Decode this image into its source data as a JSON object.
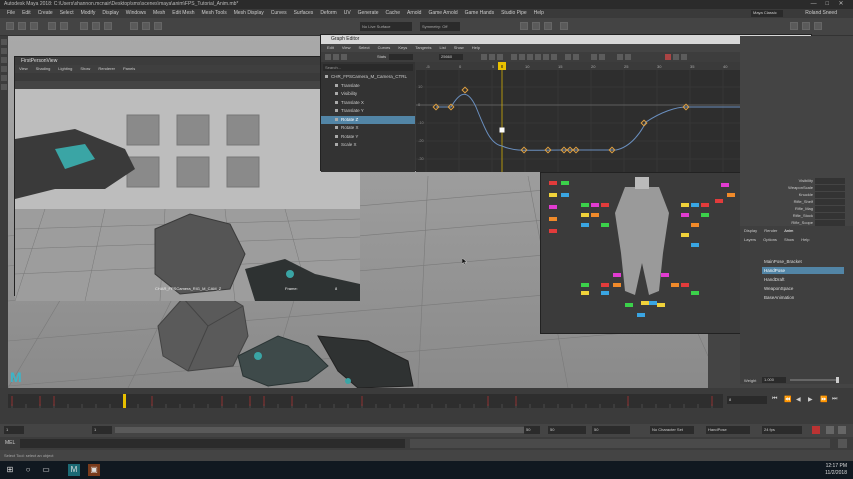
{
  "app": {
    "title": "Autodesk Maya 2018: C:\\Users\\shannon.mcnair\\Desktop\\sms\\scenes\\maya\\anim\\FPS_Tutorial_Anim.mb*",
    "window_buttons": [
      "—",
      "□",
      "✕"
    ]
  },
  "menubar": {
    "items": [
      "File",
      "Edit",
      "Create",
      "Select",
      "Modify",
      "Display",
      "Windows",
      "Mesh",
      "Edit Mesh",
      "Mesh Tools",
      "Mesh Display",
      "Curves",
      "Surfaces",
      "Deform",
      "UV",
      "Generate",
      "Cache",
      "Arnold",
      "Game Arnold",
      "Game Hands",
      "Studio Pipe",
      "Help"
    ],
    "workspace_label": "Workspace:",
    "workspace_value": "Maya Classic",
    "user": "Roland Sneed"
  },
  "shelf": {
    "fields": [
      "No Live Surface",
      "Symmetry: Off"
    ]
  },
  "camera_window": {
    "title": "FirstPersonView",
    "menu": [
      "View",
      "Shading",
      "Lighting",
      "Show",
      "Renderer",
      "Panels"
    ],
    "caption": "CHAR_FPSCamera_RIG_M_CAM_Z",
    "frame_label": "Frame:",
    "frame_value": "8"
  },
  "graph_editor": {
    "title": "Graph Editor",
    "menu": [
      "Edit",
      "View",
      "Select",
      "Curves",
      "Keys",
      "Tangents",
      "List",
      "Show",
      "Help"
    ],
    "stats_label": "Stats",
    "value_field": "25660",
    "search_placeholder": "Search...",
    "outliner": [
      {
        "label": "CHR_FPSCamera_M_Camera_CTRL",
        "selected": false
      },
      {
        "label": "Translate",
        "selected": false
      },
      {
        "label": "Visibility",
        "selected": false
      },
      {
        "label": "Translate X",
        "selected": false
      },
      {
        "label": "Translate Y",
        "selected": false
      },
      {
        "label": "Rotate Z",
        "selected": true
      },
      {
        "label": "Rotate X",
        "selected": false
      },
      {
        "label": "Rotate Y",
        "selected": false
      },
      {
        "label": "Scale X",
        "selected": false
      }
    ],
    "ruler": [
      "-5",
      "0",
      "5",
      "10",
      "15",
      "20",
      "25",
      "30",
      "35",
      "40",
      "45",
      "50"
    ],
    "y_ticks": [
      "10",
      "0",
      "-10",
      "-20",
      "-30",
      "-40"
    ],
    "current_frame": "8"
  },
  "channel_box": {
    "attrs": [
      "Visibility",
      "WeaponScale",
      "Knuckle",
      "Rifle_Shelf",
      "Rifle_Mag",
      "Rifle_Stock",
      "Rifle_Scope"
    ]
  },
  "anim_layers": {
    "tabs": [
      "Display",
      "Render",
      "Anim"
    ],
    "menu": [
      "Layers",
      "Options",
      "Show",
      "Help"
    ],
    "layers": [
      {
        "label": "MainPose_Bracket",
        "selected": false
      },
      {
        "label": "HandPose",
        "selected": true
      },
      {
        "label": "HandDraft",
        "selected": false
      },
      {
        "label": "WeaponSpace",
        "selected": false
      },
      {
        "label": "BaseAnimation",
        "selected": false
      }
    ],
    "weight_label": "Weight",
    "weight_value": "1.000"
  },
  "timeslider": {
    "current_frame": "8",
    "range_start": "1",
    "range_start_inner": "1",
    "range_end_inner": "50",
    "range_end": "50",
    "anim_end": "50",
    "character_set": "No Character Set",
    "anim_layer": "HandPose",
    "fps": "24 fps",
    "playback_buttons": [
      "⏮",
      "⏪",
      "◀",
      "▶",
      "⏩",
      "⏭"
    ]
  },
  "cmdline": {
    "lang": "MEL"
  },
  "helpline": {
    "text": "Select Tool: select an object"
  },
  "taskbar": {
    "start_icon": "windows-icon",
    "time": "12:17 PM",
    "date": "11/2/2018"
  },
  "colors": {
    "accent_blue": "#5285a6",
    "curve_blue": "#6a8fbf",
    "curve_orange": "#e0a040",
    "frame_marker": "#e8c000"
  }
}
